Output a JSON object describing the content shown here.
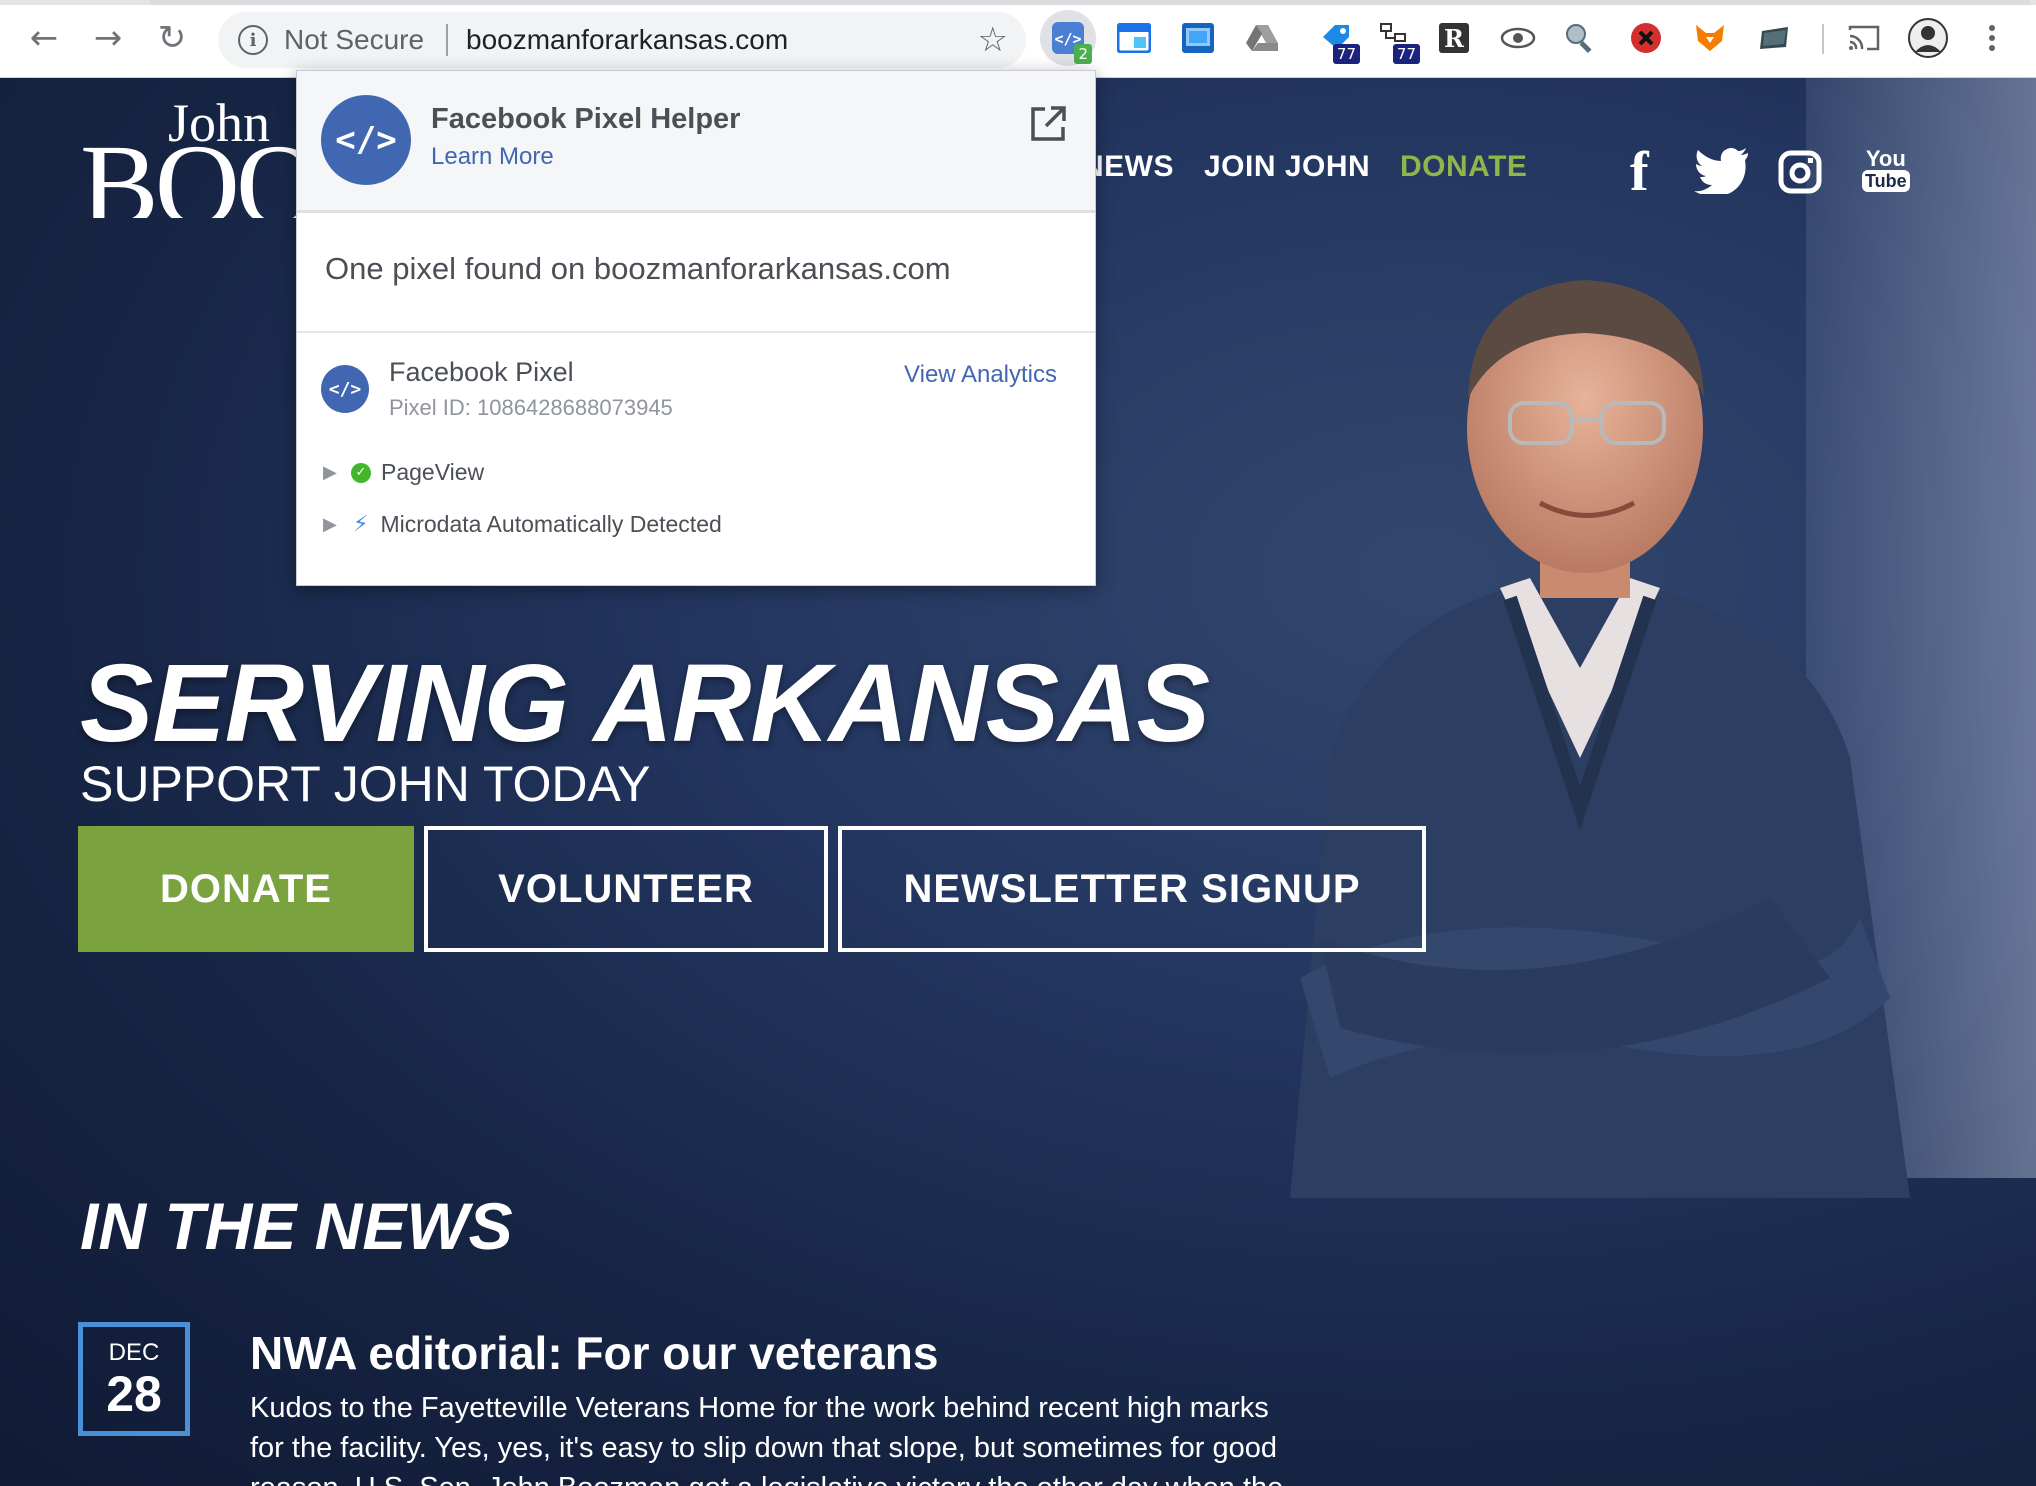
{
  "browser": {
    "security_label": "Not Secure",
    "url": "boozmanforarkansas.com",
    "extensions": [
      {
        "icon": "pixel-helper-icon",
        "badge": "2"
      },
      {
        "icon": "window-icon",
        "badge": ""
      },
      {
        "icon": "screenshot-icon",
        "badge": ""
      },
      {
        "icon": "drive-icon",
        "badge": ""
      },
      {
        "icon": "tag-icon",
        "badge": "77"
      },
      {
        "icon": "tree-icon",
        "badge": "77"
      },
      {
        "icon": "readability-icon",
        "badge": ""
      },
      {
        "icon": "eye-icon",
        "badge": ""
      },
      {
        "icon": "inspect-icon",
        "badge": ""
      },
      {
        "icon": "block-icon",
        "badge": ""
      },
      {
        "icon": "fox-icon",
        "badge": ""
      },
      {
        "icon": "folder-icon",
        "badge": ""
      }
    ]
  },
  "site": {
    "logo_top": "John",
    "logo_main": "BOO",
    "nav": {
      "news": "NEWS",
      "join": "JOIN JOHN",
      "donate": "DONATE"
    },
    "social": {
      "facebook": "f",
      "youtube_top": "You",
      "youtube_bottom": "Tube"
    },
    "hero": {
      "headline": "SERVING ARKANSAS",
      "subhead": "SUPPORT JOHN TODAY",
      "donate_btn": "DONATE",
      "volunteer_btn": "VOLUNTEER",
      "newsletter_btn": "NEWSLETTER SIGNUP"
    },
    "news": {
      "section_title": "IN THE NEWS",
      "article": {
        "month": "DEC",
        "day": "28",
        "title": "NWA editorial: For our veterans",
        "body": "Kudos to the Fayetteville Veterans Home for the work behind recent high marks for the facility. Yes, yes, it's easy to slip down that slope, but sometimes for good reason. U.S. Sen. John Boozman got a legislative victory the other day when the"
      }
    },
    "colors": {
      "accent_green": "#7aa23f",
      "date_border": "#4a90d9"
    }
  },
  "popup": {
    "title": "Facebook Pixel Helper",
    "learn_more": "Learn More",
    "found_text": "One pixel found on boozmanforarkansas.com",
    "pixel_name": "Facebook Pixel",
    "pixel_id": "Pixel ID: 1086428688073945",
    "view_analytics": "View Analytics",
    "events": [
      {
        "label": "PageView",
        "status": "success"
      },
      {
        "label": "Microdata Automatically Detected",
        "status": "info"
      }
    ],
    "colors": {
      "fb_blue": "#4267b2",
      "success_green": "#42b72a"
    }
  }
}
